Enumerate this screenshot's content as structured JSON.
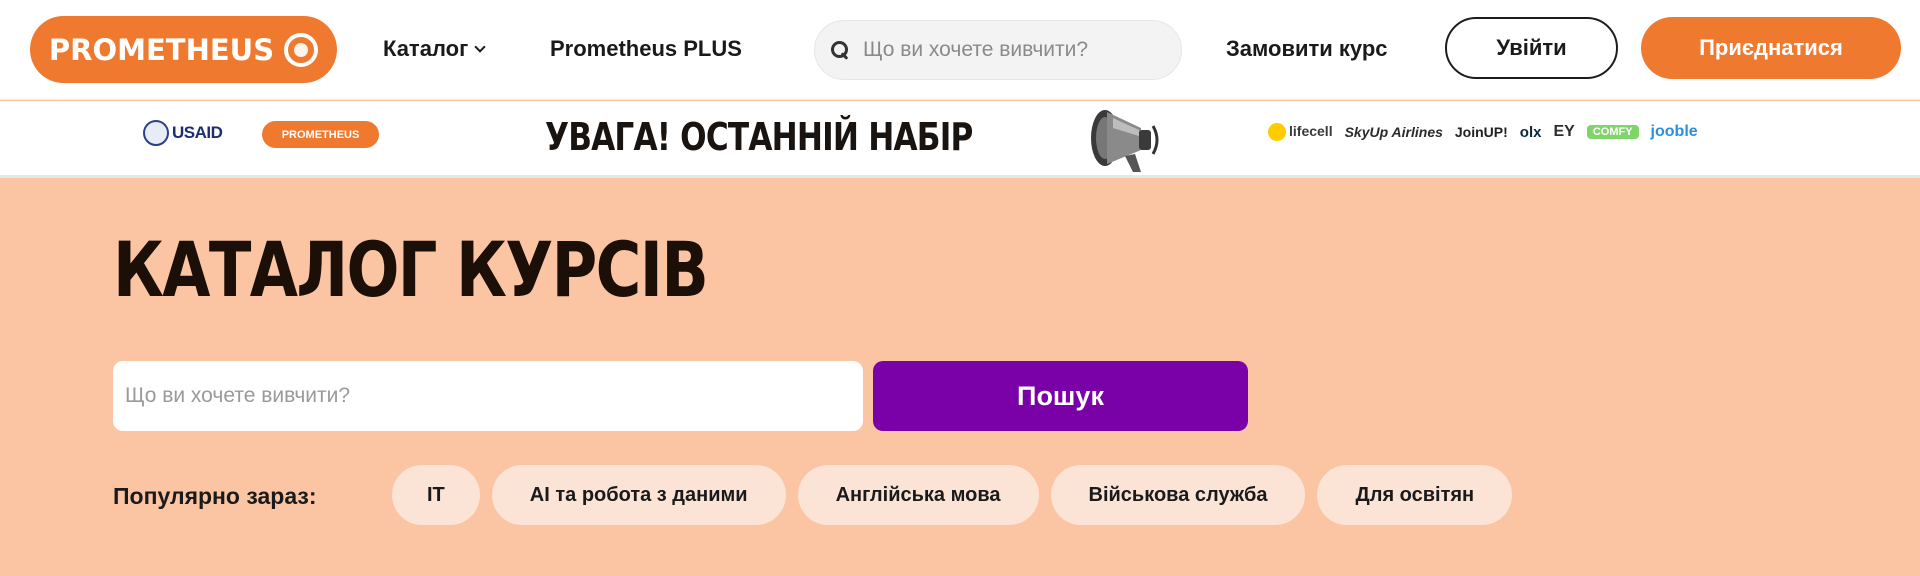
{
  "header": {
    "logo_text": "PROMETHEUS",
    "catalog_label": "Каталог",
    "plus_label": "Prometheus PLUS",
    "search_placeholder": "Що ви хочете вивчити?",
    "order_course_label": "Замовити курс",
    "login_label": "Увійти",
    "join_label": "Приєднатися"
  },
  "banner": {
    "usaid_text": "USAID",
    "mini_logo_text": "PROMETHEUS",
    "headline": "УВАГА! ОСТАННІЙ НАБІР",
    "partners": [
      "lifecell",
      "SkyUp Airlines",
      "JoinUP!",
      "olx",
      "EY",
      "COMFY",
      "jooble"
    ]
  },
  "main": {
    "title": "КАТАЛОГ КУРСІВ",
    "search_placeholder": "Що ви хочете вивчити?",
    "search_button": "Пошук",
    "popular_label": "Популярно зараз:",
    "chips": [
      "IT",
      "AI та робота з даними",
      "Англійська мова",
      "Військова служба",
      "Для освітян"
    ]
  },
  "colors": {
    "brand_orange": "#ef7a2f",
    "page_background": "#fbc5a4",
    "search_button": "#7a00a8",
    "chip_background": "#fbe3d5"
  }
}
